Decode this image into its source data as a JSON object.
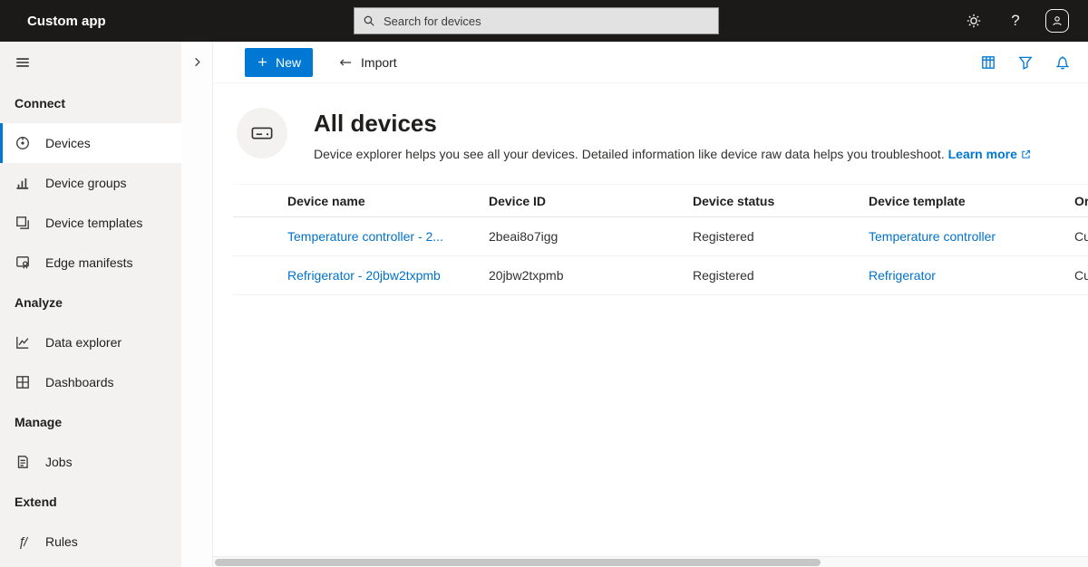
{
  "colors": {
    "accent": "#0078d4",
    "topbar_bg": "#1b1a19",
    "sidebar_bg": "#f3f2f1",
    "link": "#0072c9"
  },
  "topbar": {
    "title": "Custom app",
    "search_placeholder": "Search for devices",
    "icons": [
      "settings-icon",
      "help-icon",
      "account-icon"
    ]
  },
  "toolbar": {
    "new": "New",
    "import": "Import",
    "icons": [
      "column-options-icon",
      "filter-icon",
      "bell-icon"
    ]
  },
  "sidebar": {
    "header_connect": "Connect",
    "header_analyze": "Analyze",
    "header_manage": "Manage",
    "header_extend": "Extend",
    "items": [
      {
        "label": "Devices",
        "icon": "devices-icon",
        "selected": true
      },
      {
        "label": "Device groups",
        "icon": "device-groups-icon",
        "selected": false
      },
      {
        "label": "Device templates",
        "icon": "device-templates-icon",
        "selected": false
      },
      {
        "label": "Edge manifests",
        "icon": "edge-manifests-icon",
        "selected": false
      },
      {
        "label": "Data explorer",
        "icon": "data-explorer-icon",
        "selected": false
      },
      {
        "label": "Dashboards",
        "icon": "dashboards-icon",
        "selected": false
      },
      {
        "label": "Jobs",
        "icon": "jobs-icon",
        "selected": false
      },
      {
        "label": "Rules",
        "icon": "rules-icon",
        "selected": false
      }
    ]
  },
  "page": {
    "title": "All devices",
    "description": "Device explorer helps you see all your devices. Detailed information like device raw data helps you troubleshoot.",
    "learn_more": "Learn more"
  },
  "table": {
    "headers": [
      "Device name",
      "Device ID",
      "Device status",
      "Device template",
      "Or"
    ],
    "rows": [
      {
        "name": "Temperature controller - 2...",
        "id": "2beai8o7igg",
        "status": "Registered",
        "template": "Temperature controller",
        "org": "Cu"
      },
      {
        "name": "Refrigerator - 20jbw2txpmb",
        "id": "20jbw2txpmb",
        "status": "Registered",
        "template": "Refrigerator",
        "org": "Cu"
      }
    ]
  }
}
